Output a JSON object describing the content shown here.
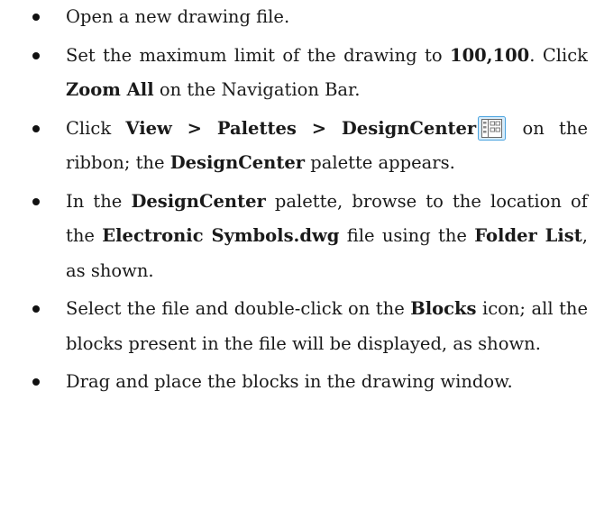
{
  "steps": [
    {
      "id": "open-file",
      "segments": [
        {
          "text": "Open a new drawing file.",
          "bold": false
        }
      ]
    },
    {
      "id": "set-limits",
      "segments": [
        {
          "text": "Set the maximum limit of the drawing to ",
          "bold": false
        },
        {
          "text": "100,100",
          "bold": true
        },
        {
          "text": ". Click ",
          "bold": false
        },
        {
          "text": "Zoom All",
          "bold": true
        },
        {
          "text": " on the Navigation Bar.",
          "bold": false
        }
      ]
    },
    {
      "id": "open-designcenter",
      "segments": [
        {
          "text": "Click ",
          "bold": false
        },
        {
          "text": "View > Palettes > DesignCenter",
          "bold": true
        },
        {
          "icon": "designcenter-icon"
        },
        {
          "text": " on the ribbon; the ",
          "bold": false
        },
        {
          "text": "DesignCenter",
          "bold": true
        },
        {
          "text": " palette appears.",
          "bold": false
        }
      ]
    },
    {
      "id": "browse-file",
      "segments": [
        {
          "text": "In the ",
          "bold": false
        },
        {
          "text": "DesignCenter",
          "bold": true
        },
        {
          "text": " palette, browse to the location of the ",
          "bold": false
        },
        {
          "text": "Electronic Symbols.dwg",
          "bold": true
        },
        {
          "text": " file using the ",
          "bold": false
        },
        {
          "text": "Folder List",
          "bold": true
        },
        {
          "text": ", as shown.",
          "bold": false
        }
      ]
    },
    {
      "id": "select-blocks",
      "segments": [
        {
          "text": "Select the file and double-click on the ",
          "bold": false
        },
        {
          "text": "Blocks",
          "bold": true
        },
        {
          "text": " icon; all the blocks present in the file will be displayed, as shown.",
          "bold": false
        }
      ]
    },
    {
      "id": "place-blocks",
      "segments": [
        {
          "text": "Drag and place the blocks in the drawing window.",
          "bold": false
        }
      ]
    }
  ],
  "colors": {
    "text": "#1a1a1a",
    "bullet": "#111111",
    "icon_border": "#4aa3df",
    "icon_fill": "#d8ecfa"
  }
}
